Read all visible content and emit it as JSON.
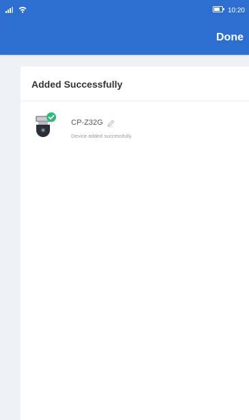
{
  "status_bar": {
    "time": "10:20",
    "icons": [
      "signal-icon",
      "wifi-icon",
      "battery-icon"
    ]
  },
  "header": {
    "done_label": "Done",
    "background": "#2d6fd0"
  },
  "card": {
    "title": "Added Successfully",
    "devices": [
      {
        "name": "CP-Z32G",
        "status": "Device added successfully",
        "icon": "camera-icon",
        "badge": "check-badge-icon"
      }
    ]
  },
  "colors": {
    "accent": "#2d6fd0",
    "success": "#2dbb7a",
    "page_background": "#eef1f5"
  }
}
